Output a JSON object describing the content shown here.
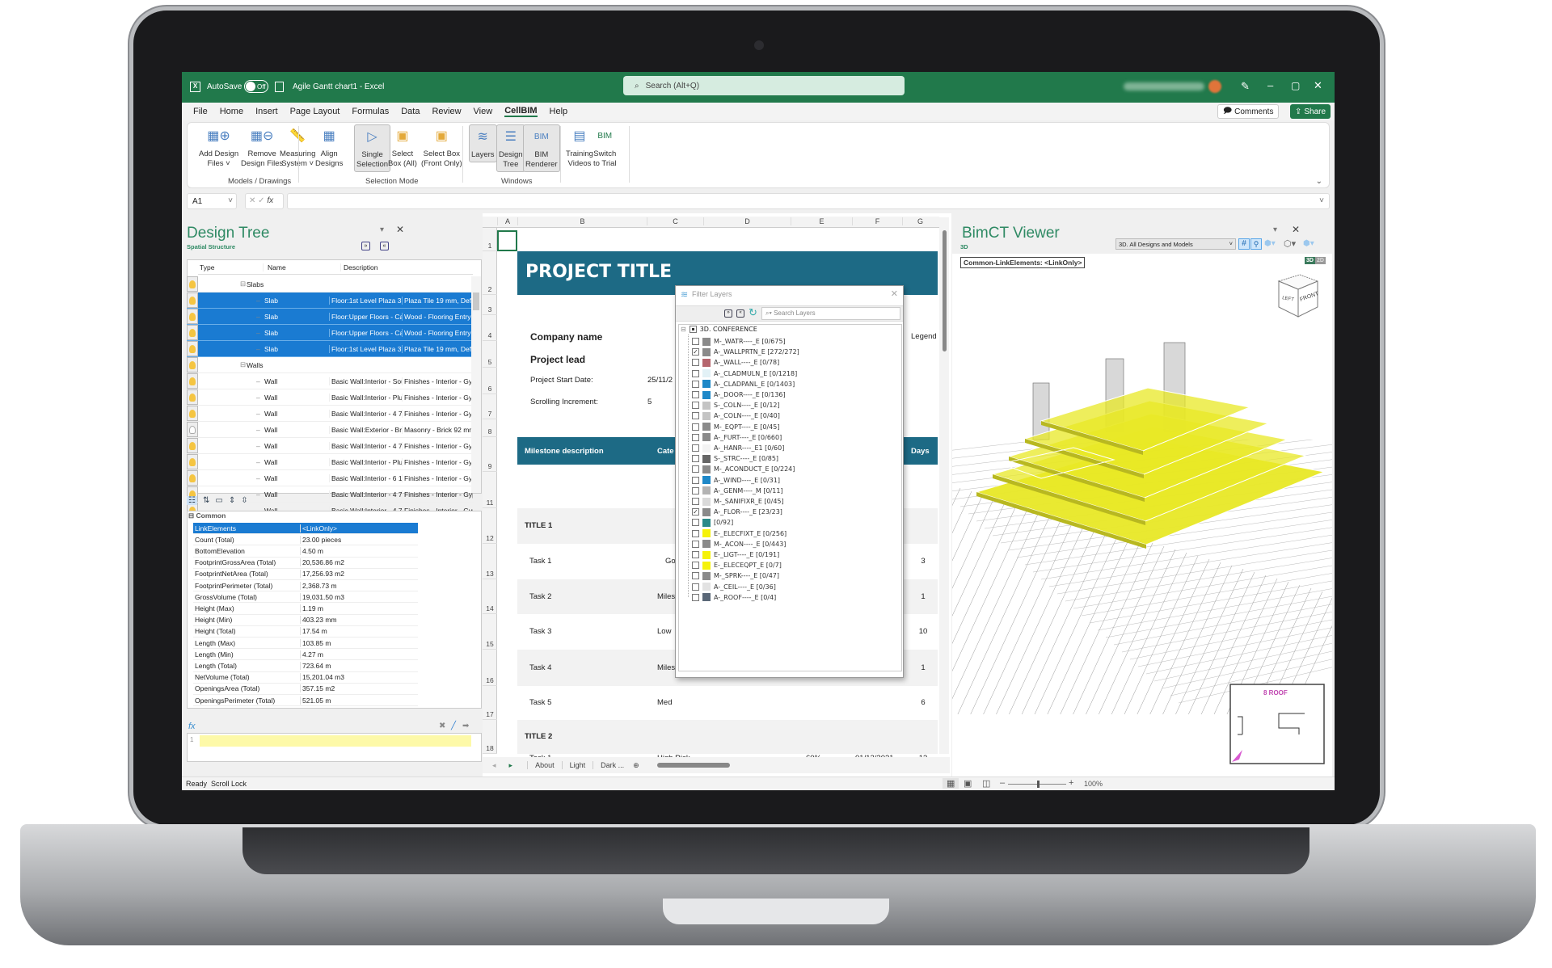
{
  "titlebar": {
    "autosave_label": "AutoSave",
    "autosave_state": "Off",
    "doc_title": "Agile Gantt chart1  -  Excel",
    "search_placeholder": "Search (Alt+Q)",
    "accent": "#21794b"
  },
  "menu": {
    "items": [
      "File",
      "Home",
      "Insert",
      "Page Layout",
      "Formulas",
      "Data",
      "Review",
      "View",
      "CellBIM",
      "Help"
    ],
    "active": "CellBIM",
    "comments": "Comments",
    "share": "Share"
  },
  "ribbon": {
    "buttons": [
      {
        "l1": "Add Design",
        "l2": "Files ˅",
        "icon": "building-add-icon"
      },
      {
        "l1": "Remove",
        "l2": "Design Files",
        "icon": "building-remove-icon"
      },
      {
        "l1": "Measuring",
        "l2": "System ˅",
        "icon": "ruler-icon"
      },
      {
        "l1": "Align",
        "l2": "Designs",
        "icon": "building-align-icon"
      },
      {
        "l1": "Single",
        "l2": "Selection",
        "icon": "cursor-icon",
        "on": true
      },
      {
        "l1": "Select",
        "l2": "Box (All)",
        "icon": "select-box-icon"
      },
      {
        "l1": "Select Box",
        "l2": "(Front Only)",
        "icon": "select-box-front-icon"
      },
      {
        "l1": "Layers",
        "l2": "",
        "icon": "layers-icon",
        "on": true
      },
      {
        "l1": "Design",
        "l2": "Tree",
        "icon": "tree-icon",
        "on": true
      },
      {
        "l1": "BIM",
        "l2": "Renderer",
        "icon": "bim-renderer-icon",
        "on": true
      },
      {
        "l1": "Training",
        "l2": "Videos",
        "icon": "film-icon"
      },
      {
        "l1": "Switch",
        "l2": "to Trial",
        "icon": "bim-icon"
      }
    ],
    "groups": [
      "Models / Drawings",
      "Selection Mode",
      "Windows"
    ]
  },
  "formula_bar": {
    "name_box": "A1",
    "fx": "fx",
    "value": ""
  },
  "design_tree": {
    "title": "Design Tree",
    "subtitle": "Spatial Structure",
    "columns": [
      "Type",
      "Name",
      "Description"
    ],
    "rows": [
      {
        "type": "Slabs",
        "group": true,
        "name": "",
        "desc": ""
      },
      {
        "type": "Slab",
        "sel": true,
        "name": "Floor:1st Level Plaza 3':...",
        "desc": "Plaza Tile 19 mm, Defa..."
      },
      {
        "type": "Slab",
        "sel": true,
        "name": "Floor:Upper Floors - Carp...",
        "desc": "Wood - Flooring Entry 19..."
      },
      {
        "type": "Slab",
        "sel": true,
        "name": "Floor:Upper Floors - Carp...",
        "desc": "Wood - Flooring Entry 19..."
      },
      {
        "type": "Slab",
        "sel": true,
        "name": "Floor:1st Level Plaza 3':...",
        "desc": "Plaza Tile 19 mm, Defa..."
      },
      {
        "type": "Walls",
        "group": true,
        "name": "",
        "desc": ""
      },
      {
        "type": "Wall",
        "name": "Basic Wall:Interior - Sou...",
        "desc": "Finishes - Interior - Gypsu..."
      },
      {
        "type": "Wall",
        "name": "Basic Wall:Interior - Plu...",
        "desc": "Finishes - Interior - Gypsu..."
      },
      {
        "type": "Wall",
        "name": "Basic Wall:Interior - 4 7/...",
        "desc": "Finishes - Interior - Gypsu..."
      },
      {
        "type": "Wall",
        "off": true,
        "name": "Basic Wall:Exterior - Bric...",
        "desc": "Masonry - Brick 92 mm, ..."
      },
      {
        "type": "Wall",
        "name": "Basic Wall:Interior - 4 7/...",
        "desc": "Finishes - Interior - Gypsu..."
      },
      {
        "type": "Wall",
        "name": "Basic Wall:Interior - Plu...",
        "desc": "Finishes - Interior - Gypsu..."
      },
      {
        "type": "Wall",
        "name": "Basic Wall:Interior - 6 1/...",
        "desc": "Finishes - Interior - Gypsu..."
      },
      {
        "type": "Wall",
        "name": "Basic Wall:Interior - 4 7/...",
        "desc": "Finishes - Interior - Gypsu..."
      },
      {
        "type": "Wall",
        "name": "Basic Wall:Interior - 4 7/...",
        "desc": "Finishes - Interior - Gypsu..."
      }
    ],
    "properties_group": "Common",
    "properties": [
      {
        "k": "LinkElements",
        "v": "<LinkOnly>",
        "sel": true
      },
      {
        "k": "Count (Total)",
        "v": "23.00 pieces"
      },
      {
        "k": "BottomElevation",
        "v": "4.50 m"
      },
      {
        "k": "FootprintGrossArea (Total)",
        "v": "20,536.86 m2"
      },
      {
        "k": "FootprintNetArea (Total)",
        "v": "17,256.93 m2"
      },
      {
        "k": "FootprintPerimeter (Total)",
        "v": "2,368.73 m"
      },
      {
        "k": "GrossVolume (Total)",
        "v": "19,031.50 m3"
      },
      {
        "k": "Height (Max)",
        "v": "1.19 m"
      },
      {
        "k": "Height (Min)",
        "v": "403.23 mm"
      },
      {
        "k": "Height (Total)",
        "v": "17.54 m"
      },
      {
        "k": "Length (Max)",
        "v": "103.85 m"
      },
      {
        "k": "Length (Min)",
        "v": "4.27 m"
      },
      {
        "k": "Length (Total)",
        "v": "723.64 m"
      },
      {
        "k": "NetVolume (Total)",
        "v": "15,201.04 m3"
      },
      {
        "k": "OpeningsArea (Total)",
        "v": "357.15 m2"
      },
      {
        "k": "OpeningsPerimeter (Total)",
        "v": "521.05 m"
      }
    ],
    "formula_label": "fx",
    "editor_line": "1"
  },
  "sheet": {
    "columns": [
      "A",
      "B",
      "C",
      "D",
      "E",
      "F",
      "G"
    ],
    "row_numbers": [
      "1",
      "2",
      "3",
      "4",
      "5",
      "6",
      "7",
      "8",
      "9",
      "11",
      "12",
      "13",
      "14",
      "15",
      "16",
      "17",
      "18"
    ],
    "project_title": "PROJECT TITLE",
    "company_name": "Company name",
    "project_lead": "Project lead",
    "legend": "Legend",
    "start_date_label": "Project Start Date:",
    "start_date_value": "25/11/2",
    "scroll_label": "Scrolling Increment:",
    "scroll_value": "5",
    "header_milestone": "Milestone description",
    "header_category": "Cate",
    "header_days": "Days",
    "header_color": "#1d6a85",
    "rows": [
      {
        "label": "TITLE 1",
        "title": true,
        "cat": "",
        "days": ""
      },
      {
        "label": "Task 1",
        "cat": "Go",
        "days": "3"
      },
      {
        "label": "Task 2",
        "cat": "Miles",
        "days": "1"
      },
      {
        "label": "Task 3",
        "cat": "Low",
        "days": "10"
      },
      {
        "label": "Task 4",
        "cat": "Miles",
        "days": "1"
      },
      {
        "label": "Task 5",
        "cat": "Med",
        "days": "6"
      },
      {
        "label": "TITLE 2",
        "title": true,
        "cat": "",
        "days": ""
      },
      {
        "label": "Task 1",
        "cat": "High Risk",
        "progress": "60%",
        "progress_value": 60,
        "date": "01/12/2021",
        "days": "13"
      }
    ],
    "tabs": [
      "About",
      "Light",
      "Dark ..."
    ]
  },
  "filter_layers": {
    "title": "Filter Layers",
    "search_placeholder": "Search Layers",
    "root": "3D. CONFERENCE",
    "layers": [
      {
        "name": "M-_WATR----_E [0/675]",
        "color": "#8a8a8a",
        "checked": false
      },
      {
        "name": "A-_WALLPRTN_E [272/272]",
        "color": "#8a8a8a",
        "checked": true
      },
      {
        "name": "A-_WALL----_E [0/78]",
        "color": "#b5656d",
        "checked": false
      },
      {
        "name": "A-_CLADMULN_E [0/1218]",
        "color": "#e2f1f6",
        "checked": false
      },
      {
        "name": "A-_CLADPANL_E [0/1403]",
        "color": "#1e88c8",
        "checked": false
      },
      {
        "name": "A-_DOOR----_E [0/136]",
        "color": "#1e88c8",
        "checked": false
      },
      {
        "name": "S-_COLN----_E [0/12]",
        "color": "#c4c4c4",
        "checked": false
      },
      {
        "name": "A-_COLN----_E [0/40]",
        "color": "#c4c4c4",
        "checked": false
      },
      {
        "name": "M-_EQPT----_E [0/45]",
        "color": "#8a8a8a",
        "checked": false
      },
      {
        "name": "A-_FURT----_E [0/660]",
        "color": "#8a8a8a",
        "checked": false
      },
      {
        "name": "A-_HANR----_E1 [0/60]",
        "color": "#f3f3f3",
        "checked": false
      },
      {
        "name": "S-_STRC----_E [0/85]",
        "color": "#666666",
        "checked": false
      },
      {
        "name": "M-_ACONDUCT_E [0/224]",
        "color": "#8a8a8a",
        "checked": false
      },
      {
        "name": "A-_WIND----_E [0/31]",
        "color": "#1e88c8",
        "checked": false
      },
      {
        "name": "A-_GENM----_M [0/11]",
        "color": "#b3b3b3",
        "checked": false
      },
      {
        "name": "M-_SANIFIXR_E [0/45]",
        "color": "#dadada",
        "checked": false
      },
      {
        "name": "A-_FLOR----_E [23/23]",
        "color": "#8a8a8a",
        "checked": true
      },
      {
        "name": "[0/92]",
        "color": "#2a8a88",
        "checked": false
      },
      {
        "name": "E-_ELECFIXT_E [0/256]",
        "color": "#f5f20a",
        "checked": false
      },
      {
        "name": "M-_ACON----_E [0/443]",
        "color": "#8a8a8a",
        "checked": false
      },
      {
        "name": "E-_LIGT----_E [0/191]",
        "color": "#f5f20a",
        "checked": false
      },
      {
        "name": "E-_ELECEQPT_E [0/7]",
        "color": "#f5f20a",
        "checked": false
      },
      {
        "name": "M-_SPRK----_E [0/47]",
        "color": "#8a8a8a",
        "checked": false
      },
      {
        "name": "A-_CEIL----_E [0/36]",
        "color": "#e2e2e2",
        "checked": false
      },
      {
        "name": "A-_ROOF----_E [0/4]",
        "color": "#5a6878",
        "checked": false
      }
    ]
  },
  "viewer": {
    "title": "BimCT Viewer",
    "mode": "3D",
    "dropdown": "3D. All Designs and Models",
    "selection_label": "Common-LinkElements: <LinkOnly>",
    "toggle_3d": "3D",
    "toggle_2d": "2D",
    "cube_left": "LEFT",
    "cube_front": "FRONT",
    "minimap_label": "8  ROOF",
    "highlight_color": "#e8e826"
  },
  "statusbar": {
    "ready": "Ready",
    "scroll_lock": "Scroll Lock",
    "zoom": "100%",
    "zoom_value": 100
  }
}
